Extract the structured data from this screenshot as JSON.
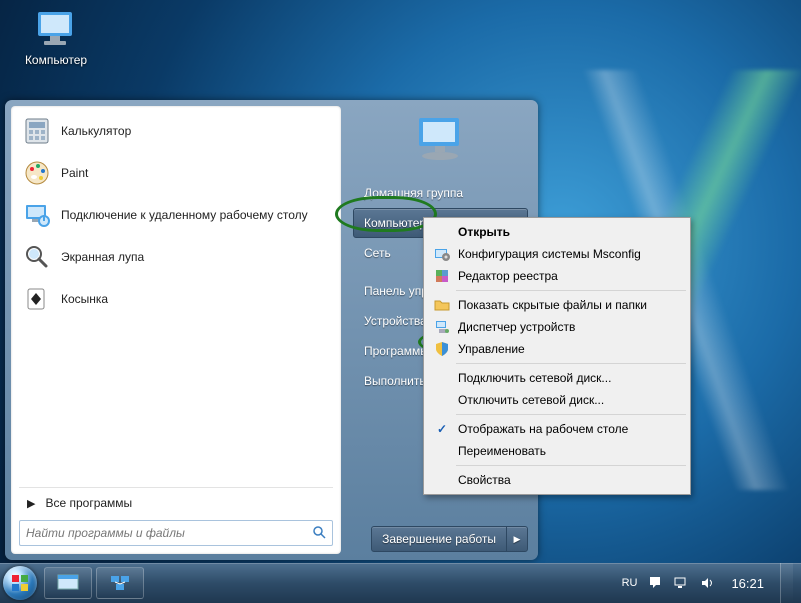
{
  "desktop": {
    "computer_label": "Компьютер"
  },
  "start_menu": {
    "programs": [
      {
        "label": "Калькулятор"
      },
      {
        "label": "Paint"
      },
      {
        "label": "Подключение к удаленному рабочему столу"
      },
      {
        "label": "Экранная лупа"
      },
      {
        "label": "Косынка"
      }
    ],
    "all_programs": "Все программы",
    "search_placeholder": "Найти программы и файлы",
    "right_items": [
      "Домашняя группа",
      "Компьютер",
      "Сеть",
      "Панель управления",
      "Устройства и принтеры",
      "Программы по умолчанию",
      "Выполнить..."
    ],
    "shutdown_label": "Завершение работы"
  },
  "context_menu": {
    "items": [
      {
        "label": "Открыть",
        "bold": true
      },
      {
        "label": "Конфигурация системы Msconfig",
        "icon": "msconfig"
      },
      {
        "label": "Редактор реестра",
        "icon": "regedit"
      },
      "---",
      {
        "label": "Показать скрытые файлы и папки",
        "icon": "folder"
      },
      {
        "label": "Диспетчер устройств",
        "icon": "device-manager"
      },
      {
        "label": "Управление",
        "icon": "shield"
      },
      "---",
      {
        "label": "Подключить сетевой диск..."
      },
      {
        "label": "Отключить сетевой диск..."
      },
      "---",
      {
        "label": "Отображать на рабочем столе",
        "icon": "check"
      },
      {
        "label": "Переименовать"
      },
      "---",
      {
        "label": "Свойства"
      }
    ]
  },
  "taskbar": {
    "language": "RU",
    "clock": "16:21"
  }
}
